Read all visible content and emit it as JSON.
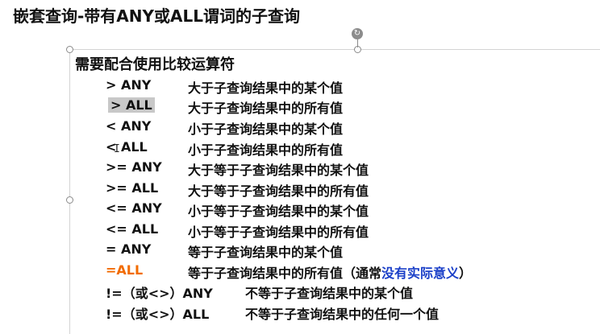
{
  "title": "嵌套查询-带有ANY或ALL谓词的子查询",
  "subtitle": "需要配合使用比较运算符",
  "rows": [
    {
      "op": "> ANY",
      "desc": "大于子查询结果中的某个值"
    },
    {
      "op": "> ALL",
      "desc": "大于子查询结果中的所有值"
    },
    {
      "op": "< ANY",
      "desc": "小于子查询结果中的某个值"
    },
    {
      "op": "< ALL",
      "desc": "小于子查询结果中的所有值"
    },
    {
      "op": ">= ANY",
      "desc": "大于等于子查询结果中的某个值"
    },
    {
      "op": ">= ALL",
      "desc": "大于等于子查询结果中的所有值"
    },
    {
      "op": "<= ANY",
      "desc": "小于等于子查询结果中的某个值"
    },
    {
      "op": "<= ALL",
      "desc": "小于等于子查询结果中的所有值"
    },
    {
      "op": "= ANY",
      "desc": "等于子查询结果中的某个值"
    },
    {
      "op": "=ALL",
      "desc": "等于子查询结果中的所有值（通常",
      "desc_note": "没有实际意义",
      "desc_end": "）"
    },
    {
      "op": "!=（或<>）ANY",
      "desc": "不等于子查询结果中的某个值"
    },
    {
      "op": "!=（或<>）ALL",
      "desc": "不等于子查询结果中的任何一个值"
    }
  ],
  "colors": {
    "orange": "#f26b00",
    "blue": "#1a3fc8",
    "highlight": "#c8c8c8"
  },
  "icons": {
    "rotate": "rotate-handle-icon",
    "cursor": "text-cursor-icon"
  }
}
